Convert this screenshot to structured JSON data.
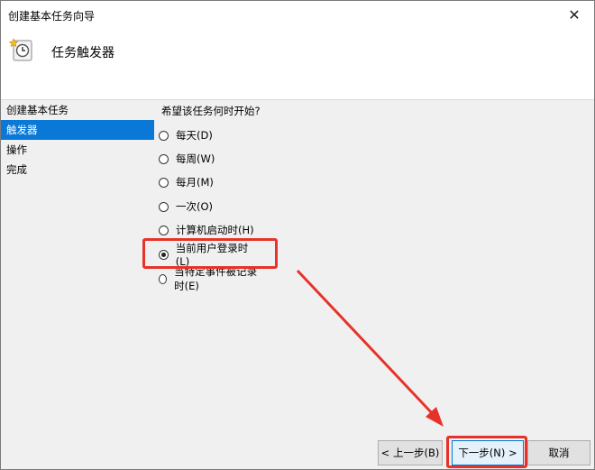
{
  "window": {
    "title": "创建基本任务向导"
  },
  "header": {
    "title": "任务触发器",
    "icon": "clock-icon"
  },
  "sidebar": {
    "items": [
      {
        "label": "创建基本任务",
        "selected": false
      },
      {
        "label": "触发器",
        "selected": true
      },
      {
        "label": "操作",
        "selected": false
      },
      {
        "label": "完成",
        "selected": false
      }
    ]
  },
  "main": {
    "question": "希望该任务何时开始?",
    "options": [
      {
        "label": "每天(D)",
        "checked": false
      },
      {
        "label": "每周(W)",
        "checked": false
      },
      {
        "label": "每月(M)",
        "checked": false
      },
      {
        "label": "一次(O)",
        "checked": false
      },
      {
        "label": "计算机启动时(H)",
        "checked": false
      },
      {
        "label": "当前用户登录时(L)",
        "checked": true
      },
      {
        "label": "当特定事件被记录时(E)",
        "checked": false
      }
    ]
  },
  "buttons": {
    "back": "< 上一步(B)",
    "next": "下一步(N) >",
    "cancel": "取消"
  },
  "colors": {
    "accent": "#0a78d7",
    "annotation": "#e6332a"
  }
}
